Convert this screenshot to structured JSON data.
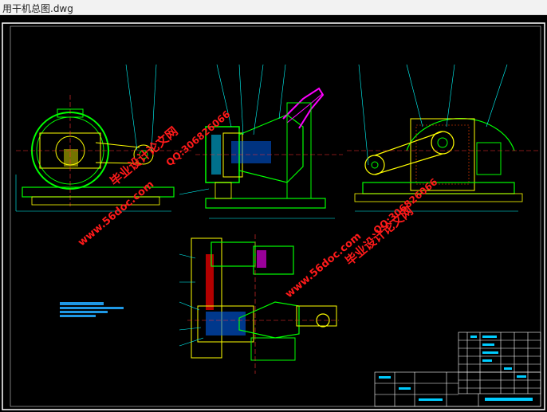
{
  "window": {
    "title": "用干机总图.dwg"
  },
  "watermarks": {
    "cn_text": "毕业设计论文网",
    "qq_text": "QQ:306826066",
    "url_text": "www.56doc.com"
  },
  "colors": {
    "canvas": "#000000",
    "frame": "#ffffff",
    "outline_green": "#00ff00",
    "outline_yellow": "#ffff00",
    "magenta": "#ff00ff",
    "cyan": "#00ffff",
    "blue": "#0066ff",
    "red": "#ff0000",
    "watermark": "#ff1a1a"
  }
}
